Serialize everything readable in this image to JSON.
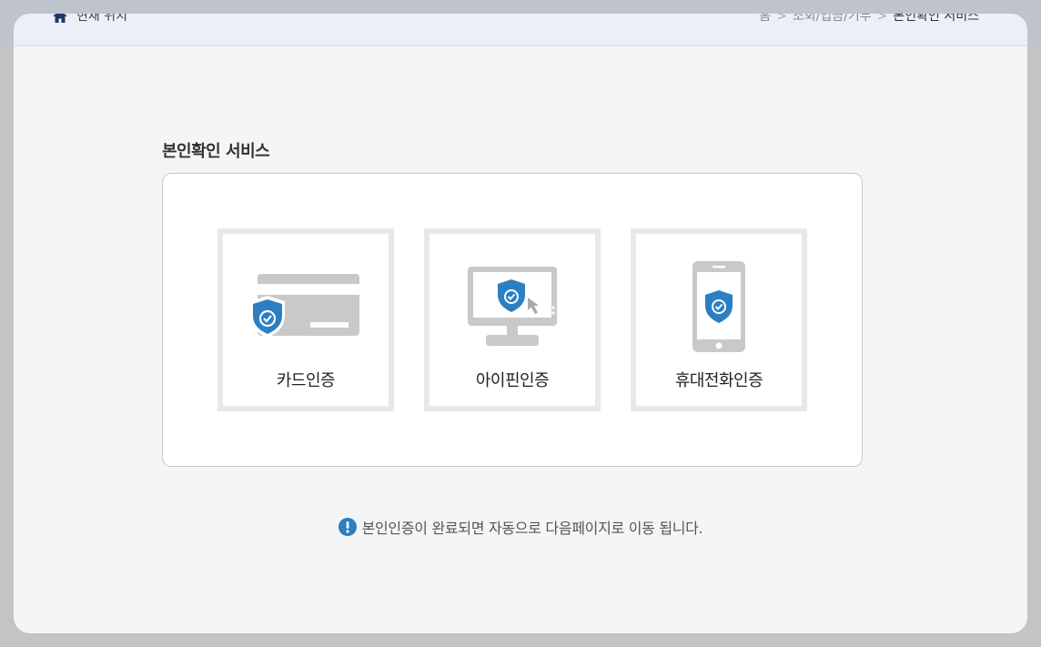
{
  "breadcrumb": {
    "location_label": "현재 위치",
    "items": [
      "홈",
      "조회/입금/기부",
      "본인확인 서비스"
    ],
    "separator": ">"
  },
  "section": {
    "title": "본인확인 서비스"
  },
  "options": [
    {
      "label": "카드인증",
      "icon": "credit-card-shield-icon"
    },
    {
      "label": "아이핀인증",
      "icon": "monitor-shield-icon"
    },
    {
      "label": "휴대전화인증",
      "icon": "mobile-phone-shield-icon"
    }
  ],
  "notice": {
    "text": "본인인증이 완료되면 자동으로 다음페이지로 이동 됩니다.",
    "icon": "exclamation-circle-icon"
  },
  "colors": {
    "accent": "#2b7fc2",
    "icon_gray": "#c9c9c9",
    "breadcrumb_bg": "#ebeff7"
  }
}
